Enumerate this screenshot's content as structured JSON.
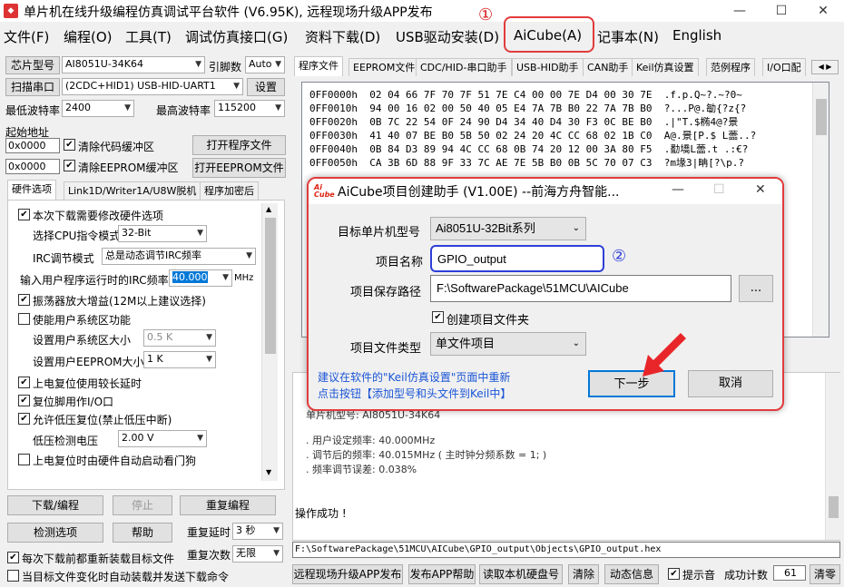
{
  "window": {
    "title": "单片机在线升级编程仿真调试平台软件 (V6.95K), 远程现场升级APP发布",
    "minimize": "—",
    "maximize": "☐",
    "close": "✕"
  },
  "menu": {
    "items": [
      "文件(F)",
      "编程(O)",
      "工具(T)",
      "调试仿真接口(G)",
      "资料下载(D)",
      "USB驱动安装(D)",
      "AiCube(A)",
      "记事本(N)",
      "English"
    ]
  },
  "annotations": {
    "marker1": "①",
    "marker2": "②"
  },
  "left": {
    "chip_model_label": "芯片型号",
    "chip_model_value": "AI8051U-34K64",
    "pin_count_label": "引脚数",
    "pin_count_value": "Auto",
    "scan_port_button": "扫描串口",
    "port_value": "(2CDC+HID1) USB-HID-UART1",
    "settings_button": "设置",
    "min_baud_label": "最低波特率",
    "min_baud_value": "2400",
    "max_baud_label": "最高波特率",
    "max_baud_value": "115200",
    "start_addr_label": "起始地址",
    "addr1": "0x0000",
    "clear_code_label": "清除代码缓冲区",
    "open_program_button": "打开程序文件",
    "addr2": "0x0000",
    "clear_eeprom_label": "清除EEPROM缓冲区",
    "open_eeprom_button": "打开EEPROM文件",
    "tabs": [
      "硬件选项",
      "Link1D/Writer1A/U8W脱机",
      "程序加密后"
    ],
    "hw": {
      "opt1": "本次下载需要修改硬件选项",
      "cpu_label": "选择CPU指令模式",
      "cpu_value": "32-Bit",
      "irc_mode_label": "IRC调节模式",
      "irc_mode_value": "总是动态调节IRC频率",
      "irc_freq_label": "输入用户程序运行时的IRC频率",
      "irc_freq_value": "40.000",
      "irc_unit": "MHz",
      "opt2": "振荡器放大增益(12M以上建议选择)",
      "opt3": "使能用户系统区功能",
      "sys_size_label": "设置用户系统区大小",
      "sys_size_value": "0.5 K",
      "eeprom_size_label": "设置用户EEPROM大小",
      "eeprom_size_value": "1    K",
      "opt4": "上电复位使用较长延时",
      "opt5": "复位脚用作I/O口",
      "opt6": "允许低压复位(禁止低压中断)",
      "lvd_label": "低压检测电压",
      "lvd_value": "2.00 V",
      "opt7": "上电复位时由硬件自动启动看门狗"
    },
    "download_button": "下载/编程",
    "stop_button": "停止",
    "reprogram_button": "重复编程",
    "check_button": "检测选项",
    "help_button": "帮助",
    "repeat_delay_label": "重复延时",
    "repeat_delay_value": "3 秒",
    "repeat_count_label": "重复次数",
    "repeat_count_value": "无限",
    "reload_label": "每次下载前都重新装载目标文件",
    "auto_send_label": "当目标文件变化时自动装载并发送下载命令"
  },
  "right": {
    "tabs": [
      "程序文件",
      "EEPROM文件",
      "CDC/HID-串口助手",
      "USB-HID助手",
      "CAN助手",
      "Keil仿真设置",
      "范例程序",
      "I/O口配"
    ],
    "hex_lines": [
      {
        "addr": "0FF0000h",
        "bytes": "02 04 66 7F 70 7F 51 7E C4 00 00 7E D4 00 30 7E",
        "ascii": ".f.p.Q~?.~?0~"
      },
      {
        "addr": "0FF0010h",
        "bytes": "94 00 16 02 00 50 40 05 E4 7A 7B B0 22 7A 7B B0",
        "ascii": "?...P@.勄{?z{?"
      },
      {
        "addr": "0FF0020h",
        "bytes": "0B 7C 22 54 0F 24 90 D4 34 40 D4 30 F3 0C BE B0",
        "ascii": ".|\"T.$椭4@?景"
      },
      {
        "addr": "0FF0030h",
        "bytes": "41 40 07 BE B0 5B 50 02 24 20 4C CC 68 02 1B C0",
        "ascii": "A@.景[P.$ L蘦..?"
      },
      {
        "addr": "0FF0040h",
        "bytes": "0B 84 D3 89 94 4C CC 68 0B 74 20 12 00 3A 80 F5",
        "ascii": ".勫墧L蘦.t .:€?"
      },
      {
        "addr": "0FF0050h",
        "bytes": "CA 3B 6D 88 9F 33 7C AE 7E 5B B0 0B 5C 70 07 C3",
        "ascii": "?m堟3|畘[?\\p.?"
      }
    ],
    "log_lines": [
      "单片机型号: AI8051U-34K64",
      ". 用户设定频率: 40.000MHz",
      ". 调节后的频率: 40.015MHz ( 主时钟分频系数 = 1; )",
      ". 频率调节误差: 0.038%"
    ],
    "log_status": "操作成功 !",
    "hex_path": "F:\\SoftwarePackage\\51MCU\\AICube\\GPIO_output\\Objects\\GPIO_output.hex",
    "bottom": {
      "remote_button": "远程现场升级APP发布",
      "publish_help_button": "发布APP帮助",
      "read_serial_button": "读取本机硬盘号",
      "clear_button": "清除",
      "dynamic_info_button": "动态信息",
      "beep_label": "提示音",
      "success_label": "成功计数",
      "success_count": "61",
      "clear_zero_button": "清零"
    }
  },
  "dialog": {
    "logo_text": "Ai Cube",
    "title": "AiCube项目创建助手 (V1.00E) --前海方舟智能...",
    "target_label": "目标单片机型号",
    "target_value": "Ai8051U-32Bit系列",
    "name_label": "项目名称",
    "name_value": "GPIO_output",
    "path_label": "项目保存路径",
    "path_value": "F:\\SoftwarePackage\\51MCU\\AICube",
    "browse_button": "...",
    "create_folder_label": "创建项目文件夹",
    "type_label": "项目文件类型",
    "type_value": "单文件项目",
    "note_line1": "建议在软件的\"Keil仿真设置\"页面中重新",
    "note_line2": "点击按钮【添加型号和头文件到Keil中】",
    "next_button": "下一步",
    "cancel_button": "取消"
  },
  "colors": {
    "annotation_red": "#e23b3b",
    "annotation_blue": "#2f3fd8",
    "note_blue": "#1a55d6"
  }
}
